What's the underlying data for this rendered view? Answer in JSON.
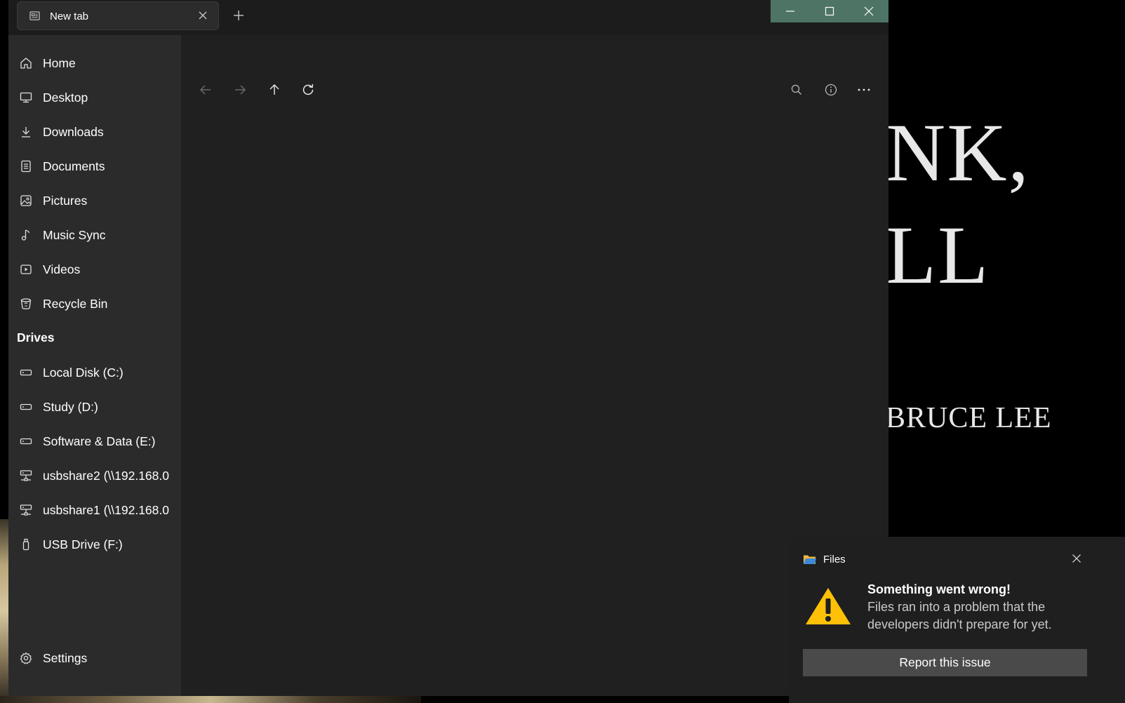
{
  "window": {
    "tab_label": "New tab",
    "accent_caption": "#4e7466"
  },
  "sidebar": {
    "items": [
      {
        "label": "Home",
        "icon": "home-icon"
      },
      {
        "label": "Desktop",
        "icon": "monitor-icon"
      },
      {
        "label": "Downloads",
        "icon": "download-icon"
      },
      {
        "label": "Documents",
        "icon": "document-icon"
      },
      {
        "label": "Pictures",
        "icon": "picture-icon"
      },
      {
        "label": "Music Sync",
        "icon": "music-note-icon"
      },
      {
        "label": "Videos",
        "icon": "video-icon"
      },
      {
        "label": "Recycle Bin",
        "icon": "recycle-bin-icon"
      }
    ],
    "drives_header": "Drives",
    "drives": [
      {
        "label": "Local Disk (C:)",
        "icon": "drive-icon"
      },
      {
        "label": "Study (D:)",
        "icon": "drive-icon"
      },
      {
        "label": "Software & Data (E:)",
        "icon": "drive-icon"
      },
      {
        "label": "usbshare2 (\\\\192.168.0",
        "icon": "network-drive-icon"
      },
      {
        "label": "usbshare1 (\\\\192.168.0",
        "icon": "network-drive-icon"
      },
      {
        "label": "USB Drive (F:)",
        "icon": "usb-drive-icon"
      }
    ],
    "settings_label": "Settings"
  },
  "desktop": {
    "poster_line1": "NK,",
    "poster_line2": "LL",
    "poster_line3": "BRUCE LEE"
  },
  "toast": {
    "app_name": "Files",
    "title": "Something went wrong!",
    "body": "Files ran into a problem that the developers didn't prepare for yet.",
    "button_label": "Report this issue",
    "warning_color": "#ffc107"
  }
}
